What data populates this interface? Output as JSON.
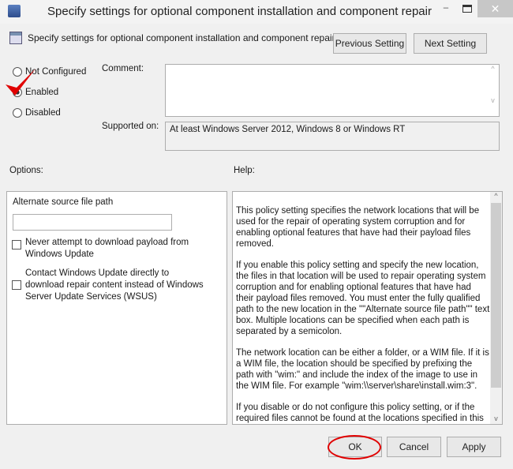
{
  "window": {
    "title": "Specify settings for optional component installation and component repair"
  },
  "header": {
    "title": "Specify settings for optional component installation and component repair",
    "previous_label": "Previous Setting",
    "next_label": "Next Setting"
  },
  "state": {
    "options": [
      "Not Configured",
      "Enabled",
      "Disabled"
    ],
    "selected": "Enabled"
  },
  "comment": {
    "label": "Comment:",
    "value": ""
  },
  "supported": {
    "label": "Supported on:",
    "value": "At least Windows Server 2012, Windows 8 or Windows RT"
  },
  "options": {
    "label": "Options:",
    "path_label": "Alternate source file path",
    "path_value": "",
    "check1": "Never attempt to download payload from Windows Update",
    "check2": "Contact Windows Update directly to download repair content instead of Windows Server Update Services (WSUS)"
  },
  "help": {
    "label": "Help:",
    "paragraphs": [
      "This policy setting specifies the network locations that will be used for the repair of operating system corruption and for enabling optional features that have had their payload files removed.",
      "If you enable this policy setting and specify the new location, the files in that location will be used to repair operating system corruption and for enabling optional features that have had their payload files removed. You must enter the fully qualified path to the new location in the \"\"Alternate source file path\"\" text box. Multiple locations can be specified when each path is separated by a semicolon.",
      "The network location can be either a folder, or a WIM file. If it is a WIM file, the location should be specified by prefixing the path with \"wim:\" and include the index of the image to use in the WIM file. For example \"wim:\\\\server\\share\\install.wim:3\".",
      "If you disable or do not configure this policy setting, or if the required files cannot be found at the locations specified in this"
    ]
  },
  "footer": {
    "ok": "OK",
    "cancel": "Cancel",
    "apply": "Apply"
  },
  "colors": {
    "annotation": "#e00000",
    "close": "#c7c7c7"
  }
}
